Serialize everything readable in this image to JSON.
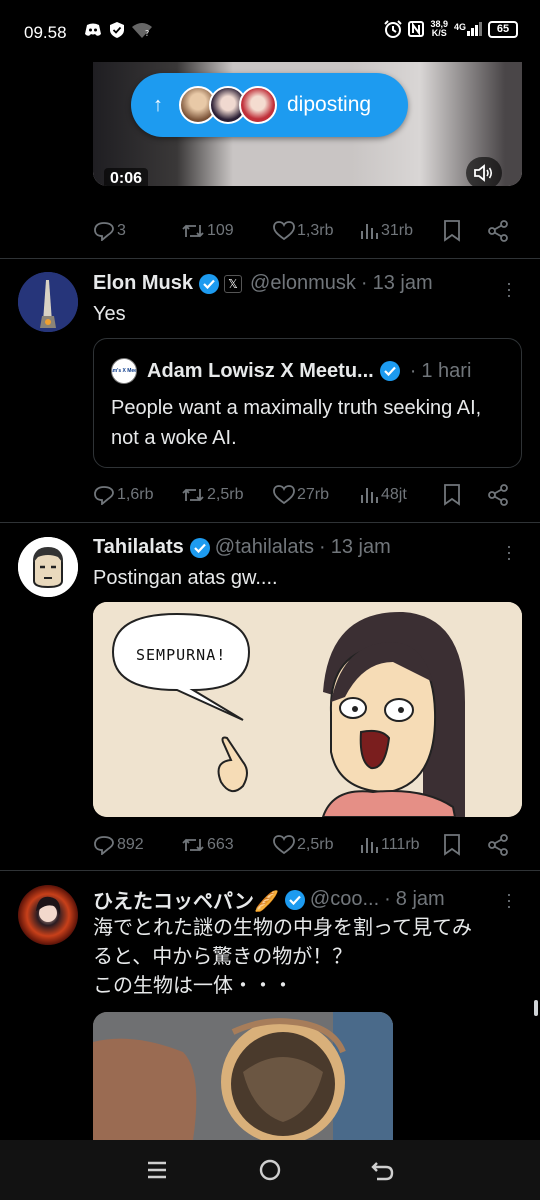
{
  "status_bar": {
    "time": "09.58",
    "net_speed_value": "38,9",
    "net_speed_unit": "K/S",
    "network": "4G",
    "battery": "65",
    "left_icons": [
      "discord-icon",
      "shield-icon",
      "wifi-question-icon"
    ],
    "right_icons": [
      "alarm-icon",
      "nfc-icon",
      "signal-icon",
      "battery-icon"
    ]
  },
  "colors": {
    "accent": "#1d9bf0",
    "muted": "#71767b",
    "text": "#e7e9ea",
    "background": "#000000",
    "divider": "#2f3336"
  },
  "posted_pill": {
    "label": "diposting",
    "icon": "arrow-up-icon"
  },
  "video": {
    "duration": "0:06",
    "volume_icon": "speaker-icon"
  },
  "tweets": [
    {
      "actions": {
        "replies": "3",
        "retweets": "109",
        "likes": "1,3rb",
        "views": "31rb"
      }
    },
    {
      "name": "Elon Musk",
      "affiliate_icon": "x-logo-icon",
      "handle": "@elonmusk",
      "dot": "·",
      "time": "13 jam",
      "text": "Yes",
      "quote": {
        "name": "Adam Lowisz X Meetu...",
        "avatar_text": "Adam's X Meetup",
        "dot": "·",
        "time": "1 hari",
        "text": "People want a maximally truth seeking AI, not a woke AI."
      },
      "actions": {
        "replies": "1,6rb",
        "retweets": "2,5rb",
        "likes": "27rb",
        "views": "48jt"
      }
    },
    {
      "name": "Tahilalats",
      "handle": "@tahilalats",
      "dot": "·",
      "time": "13 jam",
      "text": "Postingan atas gw....",
      "comic_text": "SEMPURNA!",
      "actions": {
        "replies": "892",
        "retweets": "663",
        "likes": "2,5rb",
        "views": "111rb"
      }
    },
    {
      "name": "ひえたコッペパン🥖",
      "handle": "@coo...",
      "dot": "·",
      "time": "8 jam",
      "text_lines": [
        "海でとれた謎の生物の中身を割って見てみ",
        "ると、中から驚きの物が！？",
        "この生物は一体・・・"
      ]
    }
  ],
  "nav_bar": {
    "icons": [
      "menu-icon",
      "home-circle-icon",
      "back-icon"
    ]
  }
}
